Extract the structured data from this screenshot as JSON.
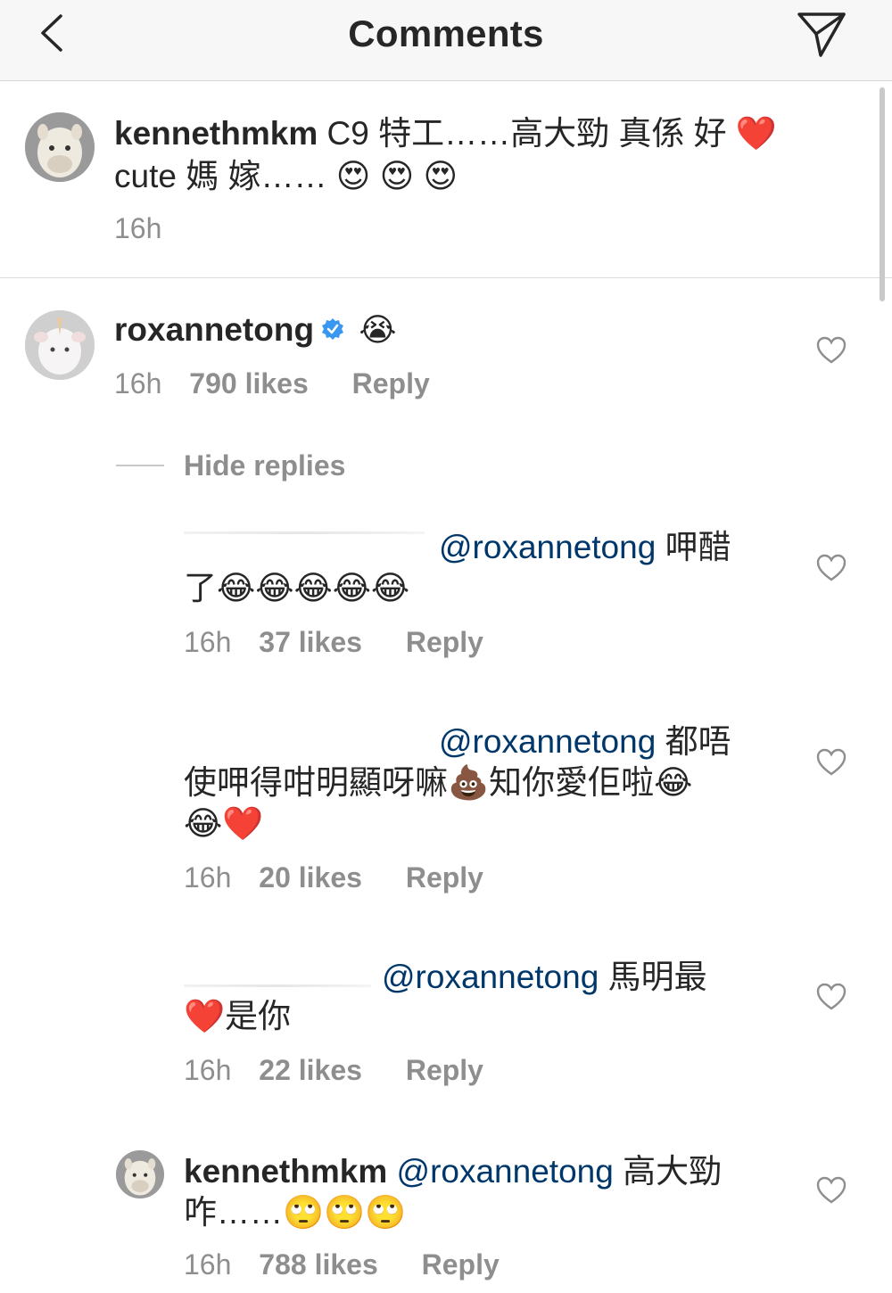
{
  "header": {
    "title": "Comments"
  },
  "caption": {
    "username": "kennethmkm",
    "text": "C9 特工……高大勁 真係 好 ❤️ cute 媽 嫁…… 😍 😍 😍",
    "time": "16h"
  },
  "comment": {
    "username": "roxannetong",
    "text": "😭",
    "time": "16h",
    "likes": "790 likes",
    "reply": "Reply"
  },
  "hide_replies": "Hide replies",
  "replies": [
    {
      "mention": "@roxannetong",
      "text_line1": "呷醋",
      "text_line2": "了😂😂😂😂😂",
      "time": "16h",
      "likes": "37 likes",
      "reply": "Reply"
    },
    {
      "mention": "@roxannetong",
      "text_line1": "都唔",
      "text_line2": "使呷得咁明顯呀嘛💩知你愛佢啦😂",
      "text_line3": "😂❤️",
      "time": "16h",
      "likes": "20 likes",
      "reply": "Reply"
    },
    {
      "mention": "@roxannetong",
      "text_line1": "馬明最",
      "text_line2": "❤️是你",
      "time": "16h",
      "likes": "22 likes",
      "reply": "Reply"
    },
    {
      "username": "kennethmkm",
      "mention": "@roxannetong",
      "text_line1": "高大勁",
      "text_line2": "咋……🙄🙄🙄",
      "time": "16h",
      "likes": "788 likes",
      "reply": "Reply"
    }
  ],
  "icons": {
    "back": "chevron-left-icon",
    "send": "paper-plane-icon",
    "like": "heart-outline-icon",
    "verified": "verified-badge-icon"
  },
  "colors": {
    "mention": "#00376b",
    "meta": "#8e8e8e",
    "verified": "#3897f0"
  }
}
